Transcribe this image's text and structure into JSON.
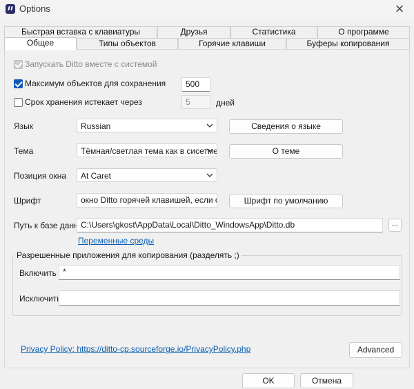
{
  "window": {
    "title": "Options"
  },
  "tabs_back": [
    "Быстрая вставка с клавиатуры",
    "Друзья",
    "Статистика",
    "О программе"
  ],
  "tabs_front": [
    "Общее",
    "Типы объектов",
    "Горячие клавиши",
    "Буферы копирования"
  ],
  "general": {
    "start_with_system": {
      "label": "Запускать Ditto вместе с системой",
      "checked": true,
      "disabled": true
    },
    "max_items": {
      "label": "Максимум объектов для сохранения",
      "checked": true,
      "value": "500"
    },
    "expire": {
      "label": "Срок хранения истекает через",
      "checked": false,
      "value": "5",
      "unit": "дней"
    },
    "language": {
      "label": "Язык",
      "value": "Russian",
      "button": "Сведения о языке"
    },
    "theme": {
      "label": "Тема",
      "value": "Тёмная/светлая тема как в сисетме",
      "button": "О теме"
    },
    "window_position": {
      "label": "Позиция окна",
      "value": "At Caret"
    },
    "font": {
      "label": "Шрифт",
      "value": "окно Ditto горячей клавишей, если оно",
      "button": "Шрифт по умолчанию"
    },
    "db_path": {
      "label": "Путь к базе данн",
      "value": "C:\\Users\\gkost\\AppData\\Local\\Ditto_WindowsApp\\Ditto.db",
      "browse": "...",
      "env_link": "Переменные среды"
    },
    "allowed_apps": {
      "title": "Разрешенные приложения для копирования (разделять ;)",
      "include_label": "Включить",
      "include_value": "*",
      "exclude_label": "Исключить",
      "exclude_value": ""
    },
    "privacy_link": "Privacy Policy: https://ditto-cp.sourceforge.io/PrivacyPolicy.php",
    "advanced_button": "Advanced"
  },
  "footer": {
    "ok": "OK",
    "cancel": "Отмена"
  },
  "colors": {
    "accent": "#0f5ab6",
    "link": "#0a5fb4",
    "window_bg": "#f0f0f0"
  }
}
